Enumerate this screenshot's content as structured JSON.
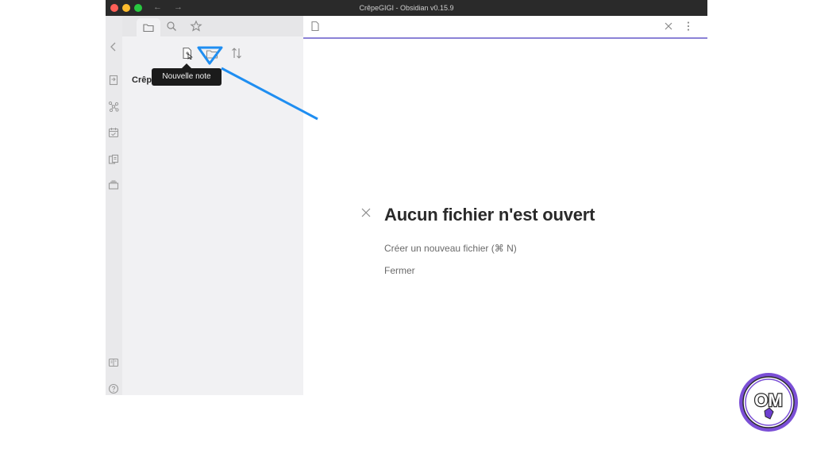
{
  "window": {
    "title": "CrêpeGIGI - Obsidian v0.15.9",
    "back_arrow": "←",
    "forward_arrow": "→"
  },
  "sidebar": {
    "tabs": [
      {
        "icon": "folder-icon",
        "active": true
      },
      {
        "icon": "search-icon",
        "active": false
      },
      {
        "icon": "star-icon",
        "active": false
      }
    ],
    "toolbar": [
      {
        "icon": "new-note-icon"
      },
      {
        "icon": "new-folder-icon"
      },
      {
        "icon": "sort-icon"
      }
    ],
    "vault_name": "Crêpe",
    "tooltip": "Nouvelle note"
  },
  "ribbon": {
    "icons": [
      "collapse-chevron-icon",
      "open-switcher-icon",
      "graph-icon",
      "daily-note-icon",
      "templates-icon",
      "slides-icon",
      "vault-icon",
      "help-icon"
    ]
  },
  "main": {
    "empty_title": "Aucun fichier n'est ouvert",
    "actions": [
      "Créer un nouveau fichier (⌘ N)",
      "Fermer"
    ]
  },
  "badge": {
    "text": "OM"
  },
  "colors": {
    "accent": "#8b82d6",
    "annotation_arrow": "#1f8ef1",
    "titlebar": "#2a2a2a",
    "sidebar": "#f1f1f3",
    "badge_purple": "#7b4fd6"
  }
}
